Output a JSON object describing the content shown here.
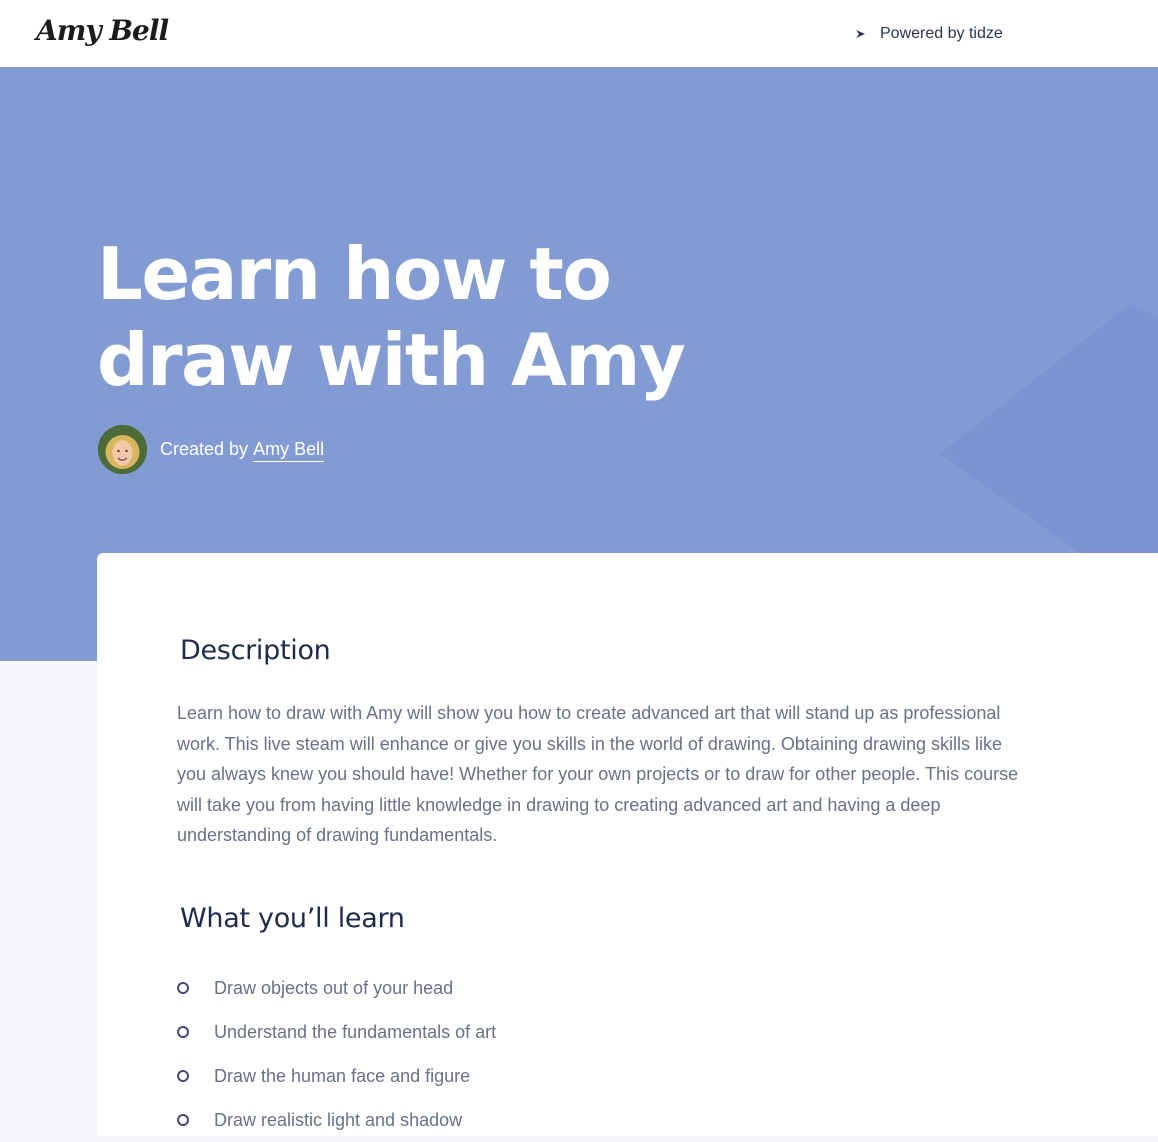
{
  "header": {
    "logo_text": "Amy Bell",
    "powered_by": "Powered by tidze",
    "powered_icon": "tidze-logo-icon"
  },
  "hero": {
    "title_line1": "Learn how to",
    "title_line2": "draw with Amy",
    "created_by_label": "Created by",
    "creator_name": "Amy Bell",
    "background_color": "#839bd3"
  },
  "description": {
    "title": "Description",
    "text": "Learn how to draw with Amy will show you how to create advanced art that will stand up as professional work. This live steam will enhance or give you skills in the world of drawing. Obtaining drawing skills like you always knew you should have! Whether for your own projects or to draw for other people. This course will take you from having little knowledge in drawing to creating advanced art and having a deep understanding of drawing fundamentals."
  },
  "learn": {
    "title": "What you’ll learn",
    "items": [
      "Draw objects out of your head",
      "Understand the fundamentals of art",
      "Draw the human face and figure",
      "Draw realistic light and shadow"
    ]
  }
}
